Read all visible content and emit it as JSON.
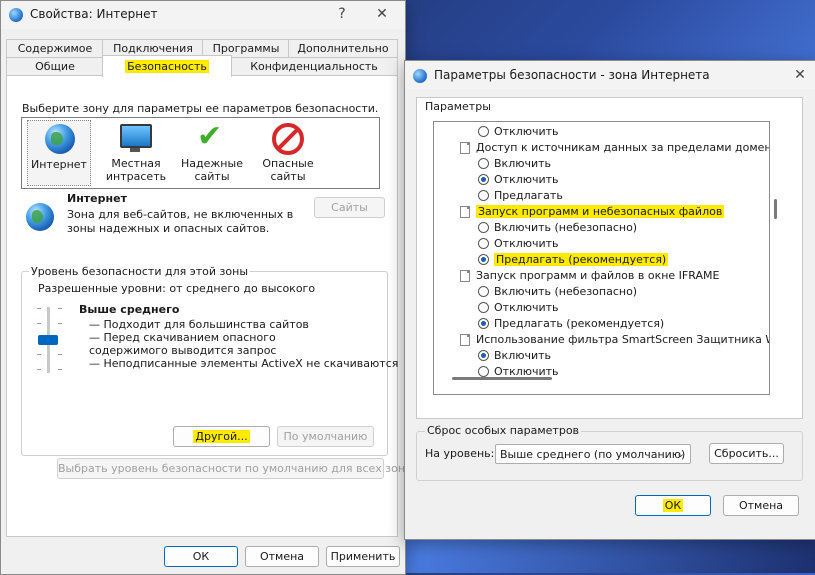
{
  "win1": {
    "title": "Свойства: Интернет",
    "help": "?",
    "close": "✕",
    "tabs_row1": [
      "Содержимое",
      "Подключения",
      "Программы",
      "Дополнительно"
    ],
    "tabs_row2": [
      "Общие",
      "Безопасность",
      "Конфиденциальность"
    ],
    "zone_prompt": "Выберите зону для параметры ее параметров безопасности.",
    "zones": [
      "Интернет",
      "Местная интрасеть",
      "Надежные сайты",
      "Опасные сайты"
    ],
    "zone_title": "Интернет",
    "zone_desc": "Зона для веб-сайтов, не включенных в зоны надежных и опасных сайтов.",
    "sites_btn": "Сайты",
    "level_group": "Уровень безопасности для этой зоны",
    "allowed_levels": "Разрешенные уровни: от среднего до высокого",
    "level_name": "Выше среднего",
    "level_items": [
      "— Подходит для большинства сайтов",
      "— Перед скачиванием опасного содержимого выводится запрос",
      "— Неподписанные элементы ActiveX не скачиваются"
    ],
    "custom_btn": "Другой...",
    "default_btn": "По умолчанию",
    "reset_all_btn": "Выбрать уровень безопасности по умолчанию для всех зон",
    "ok": "ОК",
    "cancel": "Отмена",
    "apply": "Применить"
  },
  "win2": {
    "title": "Параметры безопасности - зона Интернета",
    "close": "✕",
    "settings_label": "Параметры",
    "rows": [
      {
        "type": "radio",
        "text": "Отключить",
        "checked": false
      },
      {
        "type": "header",
        "text": "Доступ к источникам данных за пределами домена"
      },
      {
        "type": "radio",
        "text": "Включить",
        "checked": false
      },
      {
        "type": "radio",
        "text": "Отключить",
        "checked": true
      },
      {
        "type": "radio",
        "text": "Предлагать",
        "checked": false
      },
      {
        "type": "header",
        "text": "Запуск программ и небезопасных файлов",
        "highlight": true
      },
      {
        "type": "radio",
        "text": "Включить (небезопасно)",
        "checked": false
      },
      {
        "type": "radio",
        "text": "Отключить",
        "checked": false
      },
      {
        "type": "radio",
        "text": "Предлагать (рекомендуется)",
        "checked": true,
        "highlight": true
      },
      {
        "type": "header",
        "text": "Запуск программ и файлов в окне IFRAME"
      },
      {
        "type": "radio",
        "text": "Включить (небезопасно)",
        "checked": false
      },
      {
        "type": "radio",
        "text": "Отключить",
        "checked": false
      },
      {
        "type": "radio",
        "text": "Предлагать (рекомендуется)",
        "checked": true
      },
      {
        "type": "header",
        "text": "Использование фильтра SmartScreen Защитника Windows"
      },
      {
        "type": "radio",
        "text": "Включить",
        "checked": true
      },
      {
        "type": "radio",
        "text": "Отключить",
        "checked": false
      }
    ],
    "reset_group": "Сброс особых параметров",
    "level_label": "На уровень:",
    "level_value": "Выше среднего (по умолчанию)",
    "reset_btn": "Сбросить...",
    "ok": "ОК",
    "cancel": "Отмена"
  }
}
